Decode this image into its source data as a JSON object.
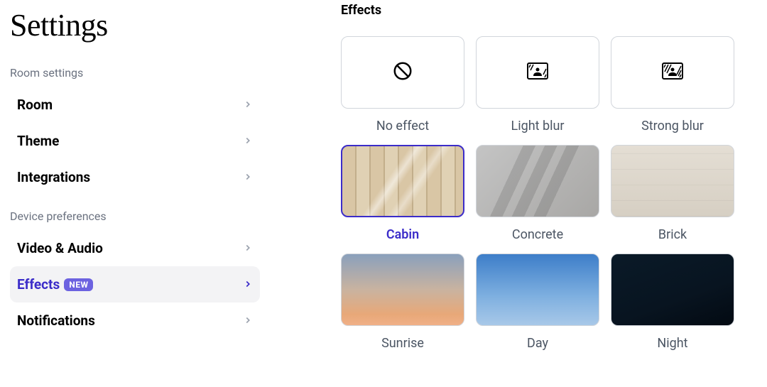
{
  "title": "Settings",
  "sidebar": {
    "sections": [
      {
        "label": "Room settings",
        "items": [
          {
            "label": "Room",
            "id": "room"
          },
          {
            "label": "Theme",
            "id": "theme"
          },
          {
            "label": "Integrations",
            "id": "integrations"
          }
        ]
      },
      {
        "label": "Device preferences",
        "items": [
          {
            "label": "Video & Audio",
            "id": "video-audio"
          },
          {
            "label": "Effects",
            "id": "effects",
            "badge": "NEW",
            "active": true
          },
          {
            "label": "Notifications",
            "id": "notifications"
          }
        ]
      }
    ]
  },
  "main": {
    "title": "Effects",
    "effects": [
      {
        "label": "No effect",
        "icon": "none"
      },
      {
        "label": "Light blur",
        "icon": "light-blur"
      },
      {
        "label": "Strong blur",
        "icon": "strong-blur"
      },
      {
        "label": "Cabin",
        "bg": "cabin",
        "selected": true
      },
      {
        "label": "Concrete",
        "bg": "concrete"
      },
      {
        "label": "Brick",
        "bg": "brick"
      },
      {
        "label": "Sunrise",
        "bg": "sunrise"
      },
      {
        "label": "Day",
        "bg": "day"
      },
      {
        "label": "Night",
        "bg": "night"
      }
    ]
  },
  "colors": {
    "accent": "#3b2cc9",
    "badge": "#6c62e0"
  }
}
